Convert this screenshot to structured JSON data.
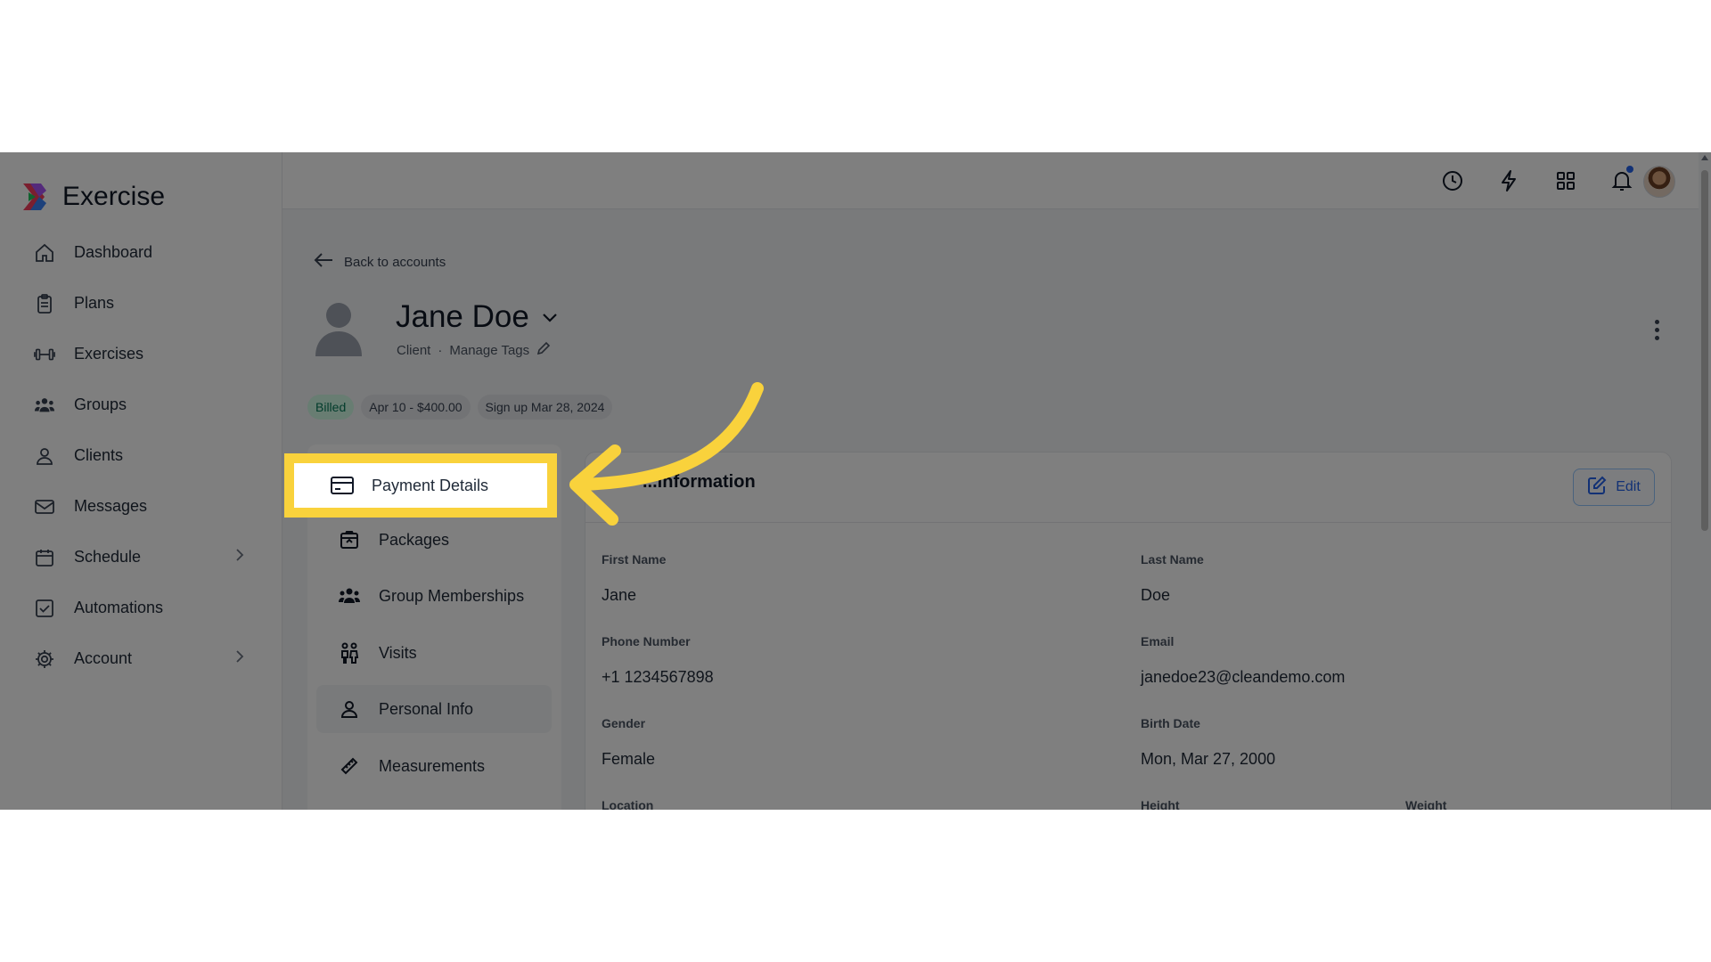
{
  "app": {
    "name": "Exercise"
  },
  "sidebar": {
    "items": [
      {
        "label": "Dashboard",
        "icon": "home-icon"
      },
      {
        "label": "Plans",
        "icon": "clipboard-icon"
      },
      {
        "label": "Exercises",
        "icon": "dumbbell-icon"
      },
      {
        "label": "Groups",
        "icon": "group-icon"
      },
      {
        "label": "Clients",
        "icon": "user-icon"
      },
      {
        "label": "Messages",
        "icon": "mail-icon"
      },
      {
        "label": "Schedule",
        "icon": "calendar-icon",
        "expandable": true
      },
      {
        "label": "Automations",
        "icon": "checkbox-icon"
      },
      {
        "label": "Account",
        "icon": "gear-icon",
        "expandable": true
      }
    ]
  },
  "header": {
    "icons": [
      "history-icon",
      "lightning-icon",
      "apps-grid-icon",
      "bell-icon"
    ],
    "notification_dot_color": "#2563eb"
  },
  "profile": {
    "back_label": "Back to accounts",
    "name": "Jane Doe",
    "role": "Client",
    "separator": "·",
    "manage_tags": "Manage Tags"
  },
  "badges": [
    {
      "label": "Billed",
      "color": "#047857"
    },
    {
      "label": "Apr 10 - $400.00"
    },
    {
      "label": "Sign up Mar 28, 2024"
    }
  ],
  "subnav": {
    "items": [
      {
        "label": "Payment Details",
        "icon": "credit-card-icon",
        "highlighted": true
      },
      {
        "label": "Packages",
        "icon": "package-icon"
      },
      {
        "label": "Group Memberships",
        "icon": "group-icon"
      },
      {
        "label": "Visits",
        "icon": "visits-icon"
      },
      {
        "label": "Personal Info",
        "icon": "user-icon",
        "active": true
      },
      {
        "label": "Measurements",
        "icon": "ruler-icon"
      }
    ]
  },
  "panel": {
    "title": "...Information",
    "edit_label": "Edit",
    "fields": {
      "first_name": {
        "label": "First Name",
        "value": "Jane"
      },
      "last_name": {
        "label": "Last Name",
        "value": "Doe"
      },
      "phone": {
        "label": "Phone Number",
        "value": "+1 1234567898"
      },
      "email": {
        "label": "Email",
        "value": "janedoe23@cleandemo.com"
      },
      "gender": {
        "label": "Gender",
        "value": "Female"
      },
      "birth_date": {
        "label": "Birth Date",
        "value": "Mon, Mar 27, 2000"
      },
      "location": {
        "label": "Location"
      },
      "height": {
        "label": "Height"
      },
      "weight": {
        "label": "Weight"
      }
    }
  },
  "annotation": {
    "highlight_color": "#f9d23c",
    "arrow_color": "#f9d23c"
  }
}
